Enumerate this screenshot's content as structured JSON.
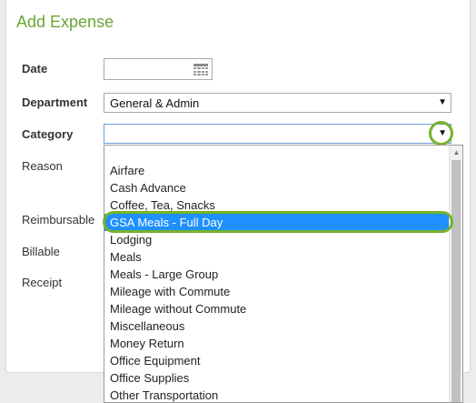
{
  "form": {
    "title": "Add Expense",
    "labels": {
      "date": "Date",
      "department": "Department",
      "category": "Category",
      "reason": "Reason",
      "reimbursable": "Reimbursable",
      "billable": "Billable",
      "receipt": "Receipt"
    },
    "date_value": "",
    "department_value": "General & Admin",
    "category_value": ""
  },
  "icons": {
    "date": "calendar-icon",
    "dropdown": "chevron-down-icon"
  },
  "colors": {
    "title": "#6aa536",
    "highlight": "#77b22c",
    "selected_option_bg": "#1e90ff"
  },
  "category_dropdown": {
    "options": [
      "Airfare",
      "Cash Advance",
      "Coffee, Tea, Snacks",
      "GSA Meals - Full Day",
      "Lodging",
      "Meals",
      "Meals - Large Group",
      "Mileage with Commute",
      "Mileage without Commute",
      "Miscellaneous",
      "Money Return",
      "Office Equipment",
      "Office Supplies",
      "Other Transportation"
    ],
    "highlighted": "GSA Meals - Full Day"
  }
}
